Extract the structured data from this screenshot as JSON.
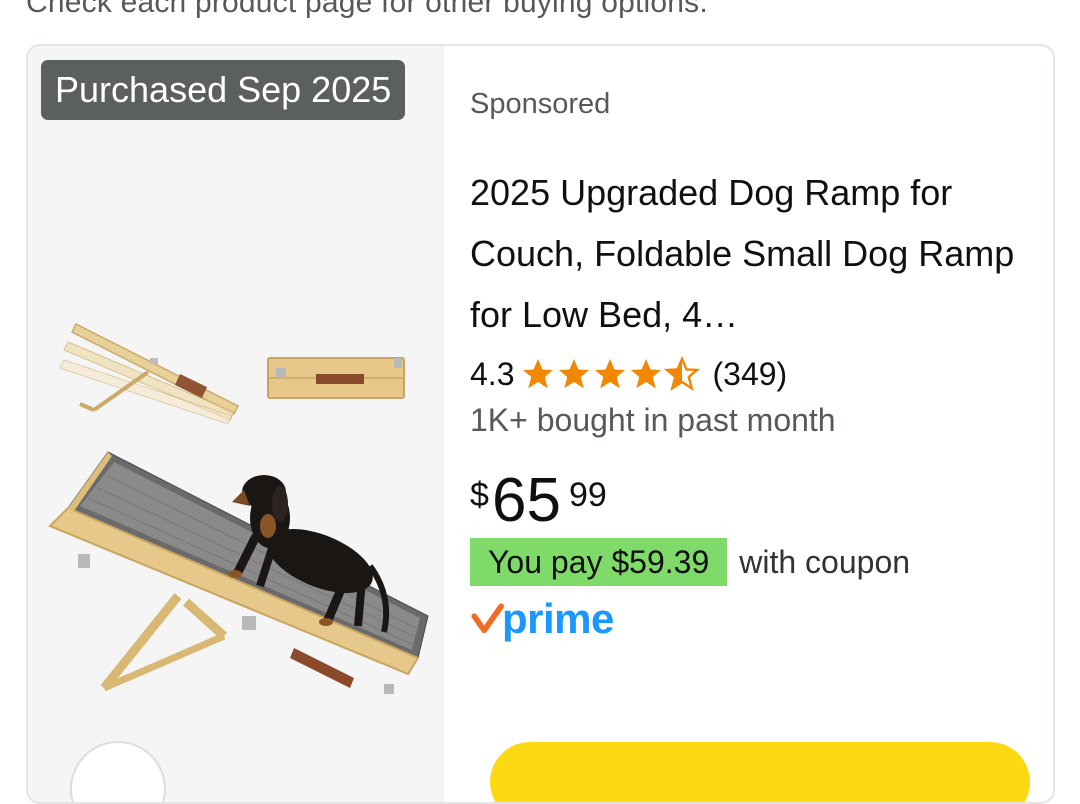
{
  "top_note": "Check each product page for other buying options.",
  "card": {
    "purchased_badge": "Purchased Sep 2025",
    "sponsored": "Sponsored",
    "title": "2025 Upgraded Dog Ramp for Couch, Foldable Small Dog Ramp for Low Bed, 4…",
    "rating": {
      "value": "4.3",
      "stars_filled": 4.3,
      "stars_total": 5,
      "count": "(349)"
    },
    "bought": "1K+ bought in past month",
    "price": {
      "symbol": "$",
      "whole": "65",
      "fraction": "99"
    },
    "coupon": {
      "you_pay": "You pay $59.39",
      "suffix": "with coupon"
    },
    "prime_label": "prime",
    "icons": {
      "star": "star-icon",
      "prime_check": "prime-check-icon",
      "product_image": "dog-ramp-image"
    },
    "colors": {
      "star": "#f08804",
      "you_pay_bg": "#7fda69",
      "prime_blue": "#1a98ff",
      "prime_check": "#f36b21",
      "badge_bg": "#5c5f5f",
      "add_button": "#ffd814"
    }
  }
}
